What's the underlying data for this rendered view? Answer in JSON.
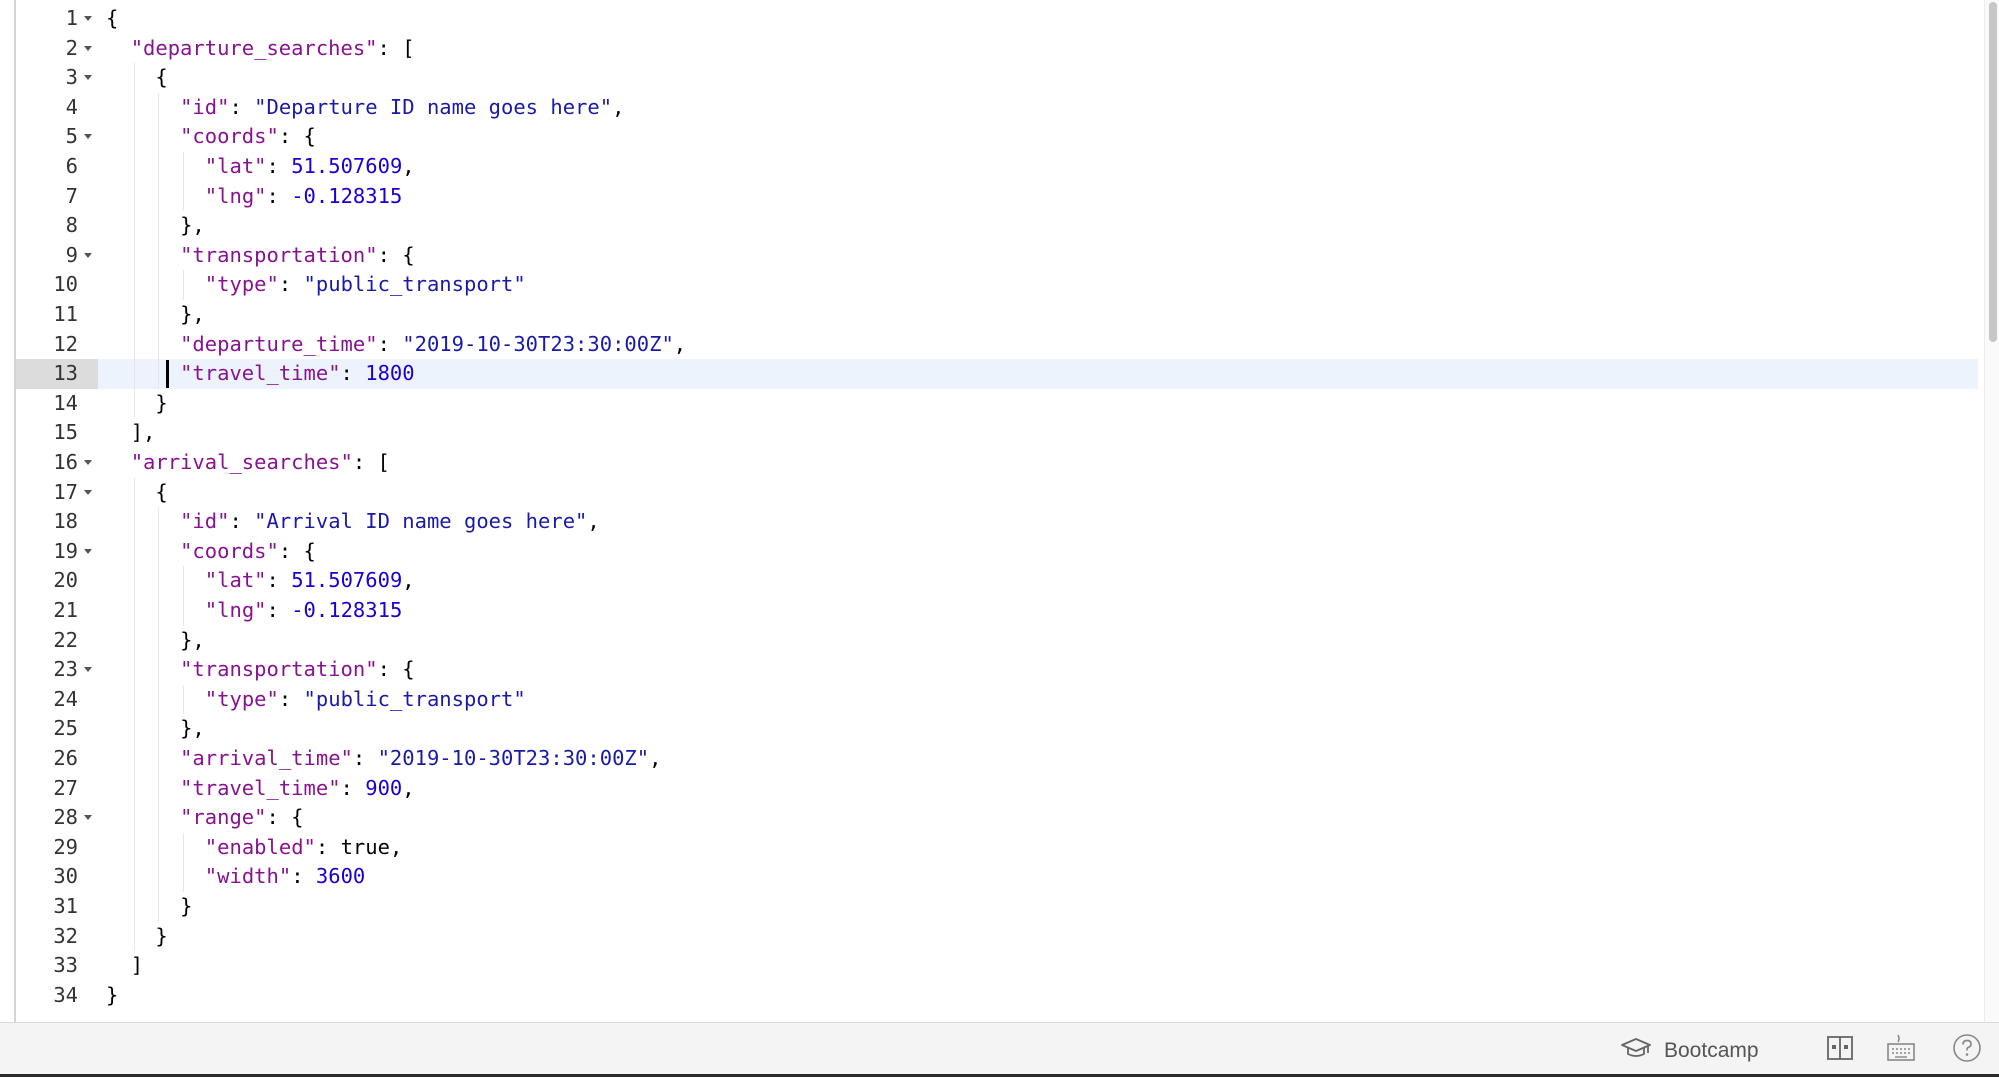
{
  "editor": {
    "language": "json",
    "active_line": 13,
    "lines": [
      {
        "n": "1",
        "fold": true,
        "indent": 0,
        "tokens": [
          {
            "t": "{",
            "c": "punc"
          }
        ]
      },
      {
        "n": "2",
        "fold": true,
        "indent": 1,
        "tokens": [
          {
            "t": "\"departure_searches\"",
            "c": "key"
          },
          {
            "t": ": [",
            "c": "punc"
          }
        ]
      },
      {
        "n": "3",
        "fold": true,
        "indent": 2,
        "tokens": [
          {
            "t": "{",
            "c": "punc"
          }
        ]
      },
      {
        "n": "4",
        "fold": false,
        "indent": 3,
        "tokens": [
          {
            "t": "\"id\"",
            "c": "key"
          },
          {
            "t": ": ",
            "c": "punc"
          },
          {
            "t": "\"Departure ID name goes here\"",
            "c": "str"
          },
          {
            "t": ",",
            "c": "punc"
          }
        ]
      },
      {
        "n": "5",
        "fold": true,
        "indent": 3,
        "tokens": [
          {
            "t": "\"coords\"",
            "c": "key"
          },
          {
            "t": ": {",
            "c": "punc"
          }
        ]
      },
      {
        "n": "6",
        "fold": false,
        "indent": 4,
        "tokens": [
          {
            "t": "\"lat\"",
            "c": "key"
          },
          {
            "t": ": ",
            "c": "punc"
          },
          {
            "t": "51.507609",
            "c": "num"
          },
          {
            "t": ",",
            "c": "punc"
          }
        ]
      },
      {
        "n": "7",
        "fold": false,
        "indent": 4,
        "tokens": [
          {
            "t": "\"lng\"",
            "c": "key"
          },
          {
            "t": ": ",
            "c": "punc"
          },
          {
            "t": "-0.128315",
            "c": "num"
          }
        ]
      },
      {
        "n": "8",
        "fold": false,
        "indent": 3,
        "tokens": [
          {
            "t": "},",
            "c": "punc"
          }
        ]
      },
      {
        "n": "9",
        "fold": true,
        "indent": 3,
        "tokens": [
          {
            "t": "\"transportation\"",
            "c": "key"
          },
          {
            "t": ": {",
            "c": "punc"
          }
        ]
      },
      {
        "n": "10",
        "fold": false,
        "indent": 4,
        "tokens": [
          {
            "t": "\"type\"",
            "c": "key"
          },
          {
            "t": ": ",
            "c": "punc"
          },
          {
            "t": "\"public_transport\"",
            "c": "str"
          }
        ]
      },
      {
        "n": "11",
        "fold": false,
        "indent": 3,
        "tokens": [
          {
            "t": "},",
            "c": "punc"
          }
        ]
      },
      {
        "n": "12",
        "fold": false,
        "indent": 3,
        "tokens": [
          {
            "t": "\"departure_time\"",
            "c": "key"
          },
          {
            "t": ": ",
            "c": "punc"
          },
          {
            "t": "\"2019-10-30T23:30:00Z\"",
            "c": "str"
          },
          {
            "t": ",",
            "c": "punc"
          }
        ]
      },
      {
        "n": "13",
        "fold": false,
        "indent": 3,
        "tokens": [
          {
            "t": "\"travel_time\"",
            "c": "key"
          },
          {
            "t": ": ",
            "c": "punc"
          },
          {
            "t": "1800",
            "c": "num"
          }
        ]
      },
      {
        "n": "14",
        "fold": false,
        "indent": 2,
        "tokens": [
          {
            "t": "}",
            "c": "punc"
          }
        ]
      },
      {
        "n": "15",
        "fold": false,
        "indent": 1,
        "tokens": [
          {
            "t": "],",
            "c": "punc"
          }
        ]
      },
      {
        "n": "16",
        "fold": true,
        "indent": 1,
        "tokens": [
          {
            "t": "\"arrival_searches\"",
            "c": "key"
          },
          {
            "t": ": [",
            "c": "punc"
          }
        ]
      },
      {
        "n": "17",
        "fold": true,
        "indent": 2,
        "tokens": [
          {
            "t": "{",
            "c": "punc"
          }
        ]
      },
      {
        "n": "18",
        "fold": false,
        "indent": 3,
        "tokens": [
          {
            "t": "\"id\"",
            "c": "key"
          },
          {
            "t": ": ",
            "c": "punc"
          },
          {
            "t": "\"Arrival ID name goes here\"",
            "c": "str"
          },
          {
            "t": ",",
            "c": "punc"
          }
        ]
      },
      {
        "n": "19",
        "fold": true,
        "indent": 3,
        "tokens": [
          {
            "t": "\"coords\"",
            "c": "key"
          },
          {
            "t": ": {",
            "c": "punc"
          }
        ]
      },
      {
        "n": "20",
        "fold": false,
        "indent": 4,
        "tokens": [
          {
            "t": "\"lat\"",
            "c": "key"
          },
          {
            "t": ": ",
            "c": "punc"
          },
          {
            "t": "51.507609",
            "c": "num"
          },
          {
            "t": ",",
            "c": "punc"
          }
        ]
      },
      {
        "n": "21",
        "fold": false,
        "indent": 4,
        "tokens": [
          {
            "t": "\"lng\"",
            "c": "key"
          },
          {
            "t": ": ",
            "c": "punc"
          },
          {
            "t": "-0.128315",
            "c": "num"
          }
        ]
      },
      {
        "n": "22",
        "fold": false,
        "indent": 3,
        "tokens": [
          {
            "t": "},",
            "c": "punc"
          }
        ]
      },
      {
        "n": "23",
        "fold": true,
        "indent": 3,
        "tokens": [
          {
            "t": "\"transportation\"",
            "c": "key"
          },
          {
            "t": ": {",
            "c": "punc"
          }
        ]
      },
      {
        "n": "24",
        "fold": false,
        "indent": 4,
        "tokens": [
          {
            "t": "\"type\"",
            "c": "key"
          },
          {
            "t": ": ",
            "c": "punc"
          },
          {
            "t": "\"public_transport\"",
            "c": "str"
          }
        ]
      },
      {
        "n": "25",
        "fold": false,
        "indent": 3,
        "tokens": [
          {
            "t": "},",
            "c": "punc"
          }
        ]
      },
      {
        "n": "26",
        "fold": false,
        "indent": 3,
        "tokens": [
          {
            "t": "\"arrival_time\"",
            "c": "key"
          },
          {
            "t": ": ",
            "c": "punc"
          },
          {
            "t": "\"2019-10-30T23:30:00Z\"",
            "c": "str"
          },
          {
            "t": ",",
            "c": "punc"
          }
        ]
      },
      {
        "n": "27",
        "fold": false,
        "indent": 3,
        "tokens": [
          {
            "t": "\"travel_time\"",
            "c": "key"
          },
          {
            "t": ": ",
            "c": "punc"
          },
          {
            "t": "900",
            "c": "num"
          },
          {
            "t": ",",
            "c": "punc"
          }
        ]
      },
      {
        "n": "28",
        "fold": true,
        "indent": 3,
        "tokens": [
          {
            "t": "\"range\"",
            "c": "key"
          },
          {
            "t": ": {",
            "c": "punc"
          }
        ]
      },
      {
        "n": "29",
        "fold": false,
        "indent": 4,
        "tokens": [
          {
            "t": "\"enabled\"",
            "c": "key"
          },
          {
            "t": ": ",
            "c": "punc"
          },
          {
            "t": "true",
            "c": "bool"
          },
          {
            "t": ",",
            "c": "punc"
          }
        ]
      },
      {
        "n": "30",
        "fold": false,
        "indent": 4,
        "tokens": [
          {
            "t": "\"width\"",
            "c": "key"
          },
          {
            "t": ": ",
            "c": "punc"
          },
          {
            "t": "3600",
            "c": "num"
          }
        ]
      },
      {
        "n": "31",
        "fold": false,
        "indent": 3,
        "tokens": [
          {
            "t": "}",
            "c": "punc"
          }
        ]
      },
      {
        "n": "32",
        "fold": false,
        "indent": 2,
        "tokens": [
          {
            "t": "}",
            "c": "punc"
          }
        ]
      },
      {
        "n": "33",
        "fold": false,
        "indent": 1,
        "tokens": [
          {
            "t": "]",
            "c": "punc"
          }
        ]
      },
      {
        "n": "34",
        "fold": false,
        "indent": 0,
        "tokens": [
          {
            "t": "}",
            "c": "punc"
          }
        ]
      }
    ]
  },
  "statusbar": {
    "bootcamp_icon": "graduation-cap-icon",
    "bootcamp_label": "Bootcamp",
    "layout_icon": "split-view-icon",
    "keyboard_icon": "keyboard-icon",
    "help_icon": "help-icon"
  },
  "colors": {
    "key": "#881391",
    "string": "#1a1aa6",
    "number": "#1c00cf",
    "active_line_bg": "#edf3fd",
    "active_gutter_bg": "#dcdcdc"
  }
}
